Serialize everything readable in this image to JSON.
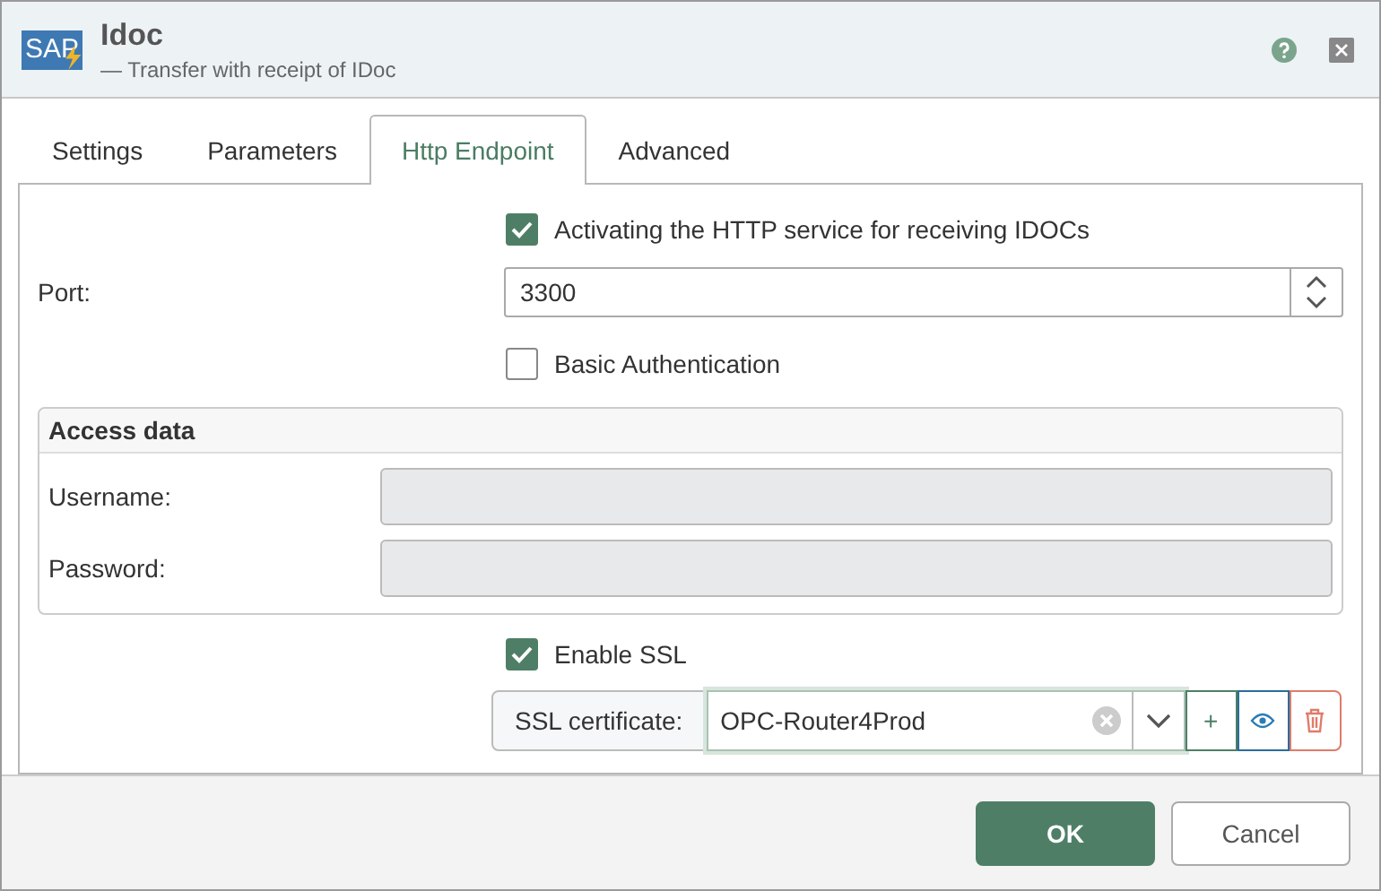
{
  "window": {
    "logo": "SAP",
    "title": "Idoc",
    "subtitle": "— Transfer with receipt of IDoc"
  },
  "tabs": [
    {
      "label": "Settings",
      "selected": false
    },
    {
      "label": "Parameters",
      "selected": false
    },
    {
      "label": "Http Endpoint",
      "selected": true
    },
    {
      "label": "Advanced",
      "selected": false
    }
  ],
  "http_service": {
    "label": "Activating the HTTP service for receiving IDOCs",
    "checked": true
  },
  "port": {
    "label": "Port:",
    "value": "3300"
  },
  "basic_auth": {
    "label": "Basic Authentication",
    "checked": false
  },
  "access_data": {
    "title": "Access data",
    "fields": [
      {
        "label": "Username:",
        "disabled": true
      },
      {
        "label": "Password:",
        "disabled": true
      }
    ]
  },
  "enable_ssl": {
    "label": "Enable SSL",
    "checked": true
  },
  "ssl_certificate": {
    "label": "SSL certificate:",
    "value": "OPC-Router4Prod",
    "add": "+"
  },
  "buttons": [
    {
      "label": "OK",
      "kind": "primary"
    },
    {
      "label": "Cancel",
      "kind": "secondary"
    }
  ]
}
